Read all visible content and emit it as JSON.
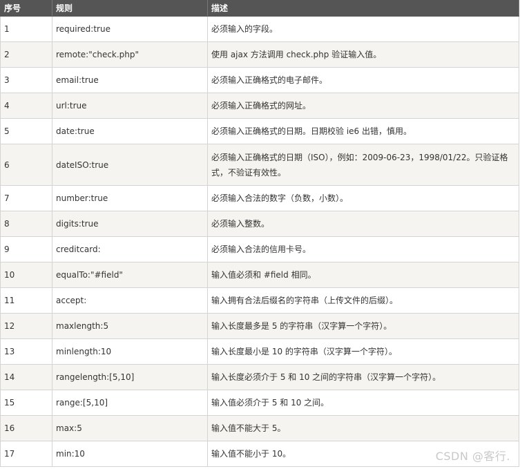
{
  "table": {
    "headers": [
      "序号",
      "规则",
      "描述"
    ],
    "rows": [
      [
        "1",
        "required:true",
        "必须输入的字段。"
      ],
      [
        "2",
        "remote:\"check.php\"",
        "使用 ajax 方法调用 check.php 验证输入值。"
      ],
      [
        "3",
        "email:true",
        "必须输入正确格式的电子邮件。"
      ],
      [
        "4",
        "url:true",
        "必须输入正确格式的网址。"
      ],
      [
        "5",
        "date:true",
        "必须输入正确格式的日期。日期校验 ie6 出错，慎用。"
      ],
      [
        "6",
        "dateISO:true",
        "必须输入正确格式的日期（ISO），例如：2009-06-23，1998/01/22。只验证格式，不验证有效性。"
      ],
      [
        "7",
        "number:true",
        "必须输入合法的数字（负数，小数）。"
      ],
      [
        "8",
        "digits:true",
        "必须输入整数。"
      ],
      [
        "9",
        "creditcard:",
        "必须输入合法的信用卡号。"
      ],
      [
        "10",
        "equalTo:\"#field\"",
        "输入值必须和 #field 相同。"
      ],
      [
        "11",
        "accept:",
        "输入拥有合法后缀名的字符串（上传文件的后缀）。"
      ],
      [
        "12",
        "maxlength:5",
        "输入长度最多是 5 的字符串（汉字算一个字符）。"
      ],
      [
        "13",
        "minlength:10",
        "输入长度最小是 10 的字符串（汉字算一个字符）。"
      ],
      [
        "14",
        "rangelength:[5,10]",
        "输入长度必须介于 5 和 10 之间的字符串（汉字算一个字符）。"
      ],
      [
        "15",
        "range:[5,10]",
        "输入值必须介于 5 和 10 之间。"
      ],
      [
        "16",
        "max:5",
        "输入值不能大于 5。"
      ],
      [
        "17",
        "min:10",
        "输入值不能小于 10。"
      ]
    ]
  },
  "watermark": "CSDN @客行."
}
